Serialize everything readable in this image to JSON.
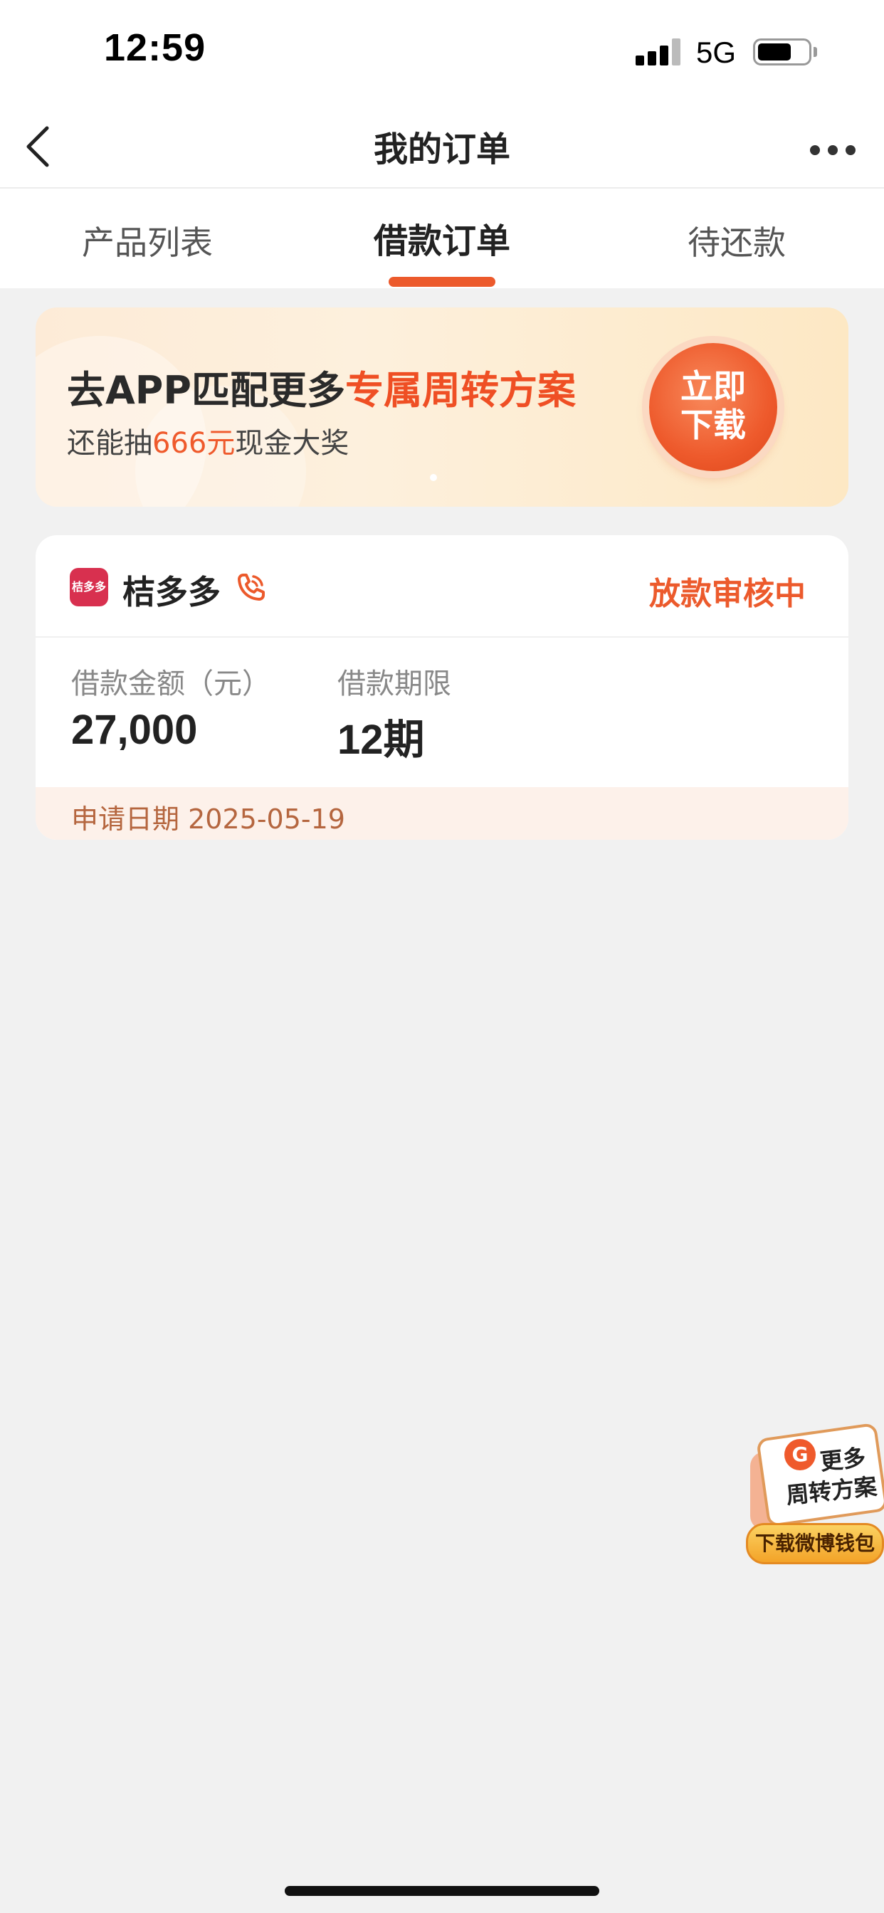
{
  "status_bar": {
    "time": "12:59",
    "network": "5G",
    "battery_level": 0.7
  },
  "nav": {
    "title": "我的订单"
  },
  "tabs": [
    {
      "label": "产品列表",
      "active": false
    },
    {
      "label": "借款订单",
      "active": true
    },
    {
      "label": "待还款",
      "active": false
    }
  ],
  "banner": {
    "headline_prefix": "去APP匹配更多",
    "headline_highlight": "专属周转方案",
    "sub_prefix": "还能抽",
    "sub_highlight": "666元",
    "sub_suffix": "现金大奖",
    "button_line1": "立即",
    "button_line2": "下载"
  },
  "order": {
    "logo_text": "桔多多",
    "app_name": "桔多多",
    "status": "放款审核中",
    "amount_label": "借款金额（元）",
    "amount_value": "27,000",
    "term_label": "借款期限",
    "term_value": "12期",
    "apply_date_label": "申请日期",
    "apply_date": "2025-05-19"
  },
  "float_widget": {
    "line1": "更多",
    "line2": "周转方案",
    "button": "下载微博钱包"
  },
  "colors": {
    "accent": "#ec5a2c",
    "page_bg": "#f1f1f1",
    "footer_text": "#b5663f"
  }
}
